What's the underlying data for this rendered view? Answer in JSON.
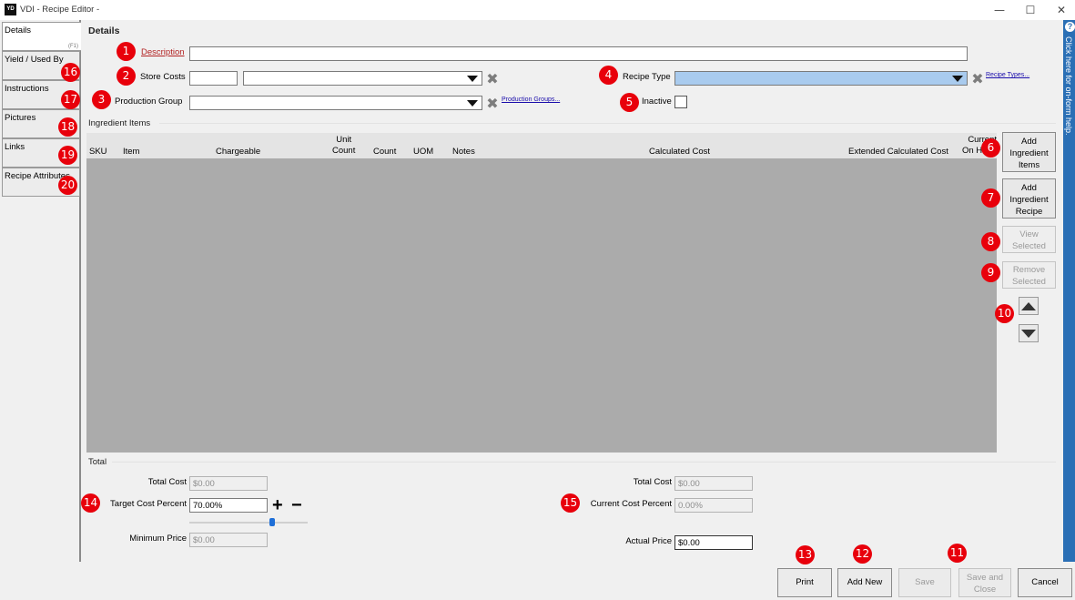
{
  "window": {
    "icon_text": "YD",
    "title": "VDI - Recipe Editor -",
    "minimize": "—",
    "maximize": "☐",
    "close": "✕"
  },
  "sidebar": {
    "tabs": [
      {
        "label": "Details",
        "key": "(F1)"
      },
      {
        "label": "Yield / Used By"
      },
      {
        "label": "Instructions"
      },
      {
        "label": "Pictures"
      },
      {
        "label": "Links"
      },
      {
        "label": "Recipe Attributes"
      }
    ]
  },
  "badges": [
    "1",
    "2",
    "3",
    "4",
    "5",
    "6",
    "7",
    "8",
    "9",
    "10",
    "11",
    "12",
    "13",
    "14",
    "15",
    "16",
    "17",
    "18",
    "19",
    "20"
  ],
  "details": {
    "heading": "Details",
    "description_label": "Description",
    "description_value": "",
    "store_costs_label": "Store Costs",
    "store_costs_value": "",
    "production_group_label": "Production Group",
    "production_groups_link": "Production Groups...",
    "recipe_type_label": "Recipe Type",
    "recipe_types_link": "Recipe Types...",
    "inactive_label": "Inactive",
    "inactive_checked": false
  },
  "ingredients": {
    "section_label": "Ingredient Items",
    "columns": [
      {
        "label": "SKU"
      },
      {
        "label": "Item"
      },
      {
        "label": "Chargeable"
      },
      {
        "label": "Unit\nCount"
      },
      {
        "label": "Count"
      },
      {
        "label": "UOM"
      },
      {
        "label": "Notes"
      },
      {
        "label": "Calculated Cost"
      },
      {
        "label": "Extended Calculated Cost"
      },
      {
        "label": "Current\nOn Hand"
      }
    ],
    "rows": [],
    "side_buttons": {
      "add_items": "Add\nIngredient\nItems",
      "add_recipe": "Add\nIngredient\nRecipe",
      "view_selected": "View\nSelected",
      "remove_selected": "Remove\nSelected"
    }
  },
  "totals": {
    "section_label": "Total",
    "total_cost_label": "Total Cost",
    "total_cost_value": "$0.00",
    "target_cost_percent_label": "Target Cost Percent",
    "target_cost_percent_value": "70.00%",
    "target_cost_slider_fraction": 0.7,
    "plus_symbol": "+",
    "minus_symbol": "−",
    "minimum_price_label": "Minimum Price",
    "minimum_price_value": "$0.00",
    "current_total_cost_label": "Total Cost",
    "current_total_cost_value": "$0.00",
    "current_cost_percent_label": "Current Cost Percent",
    "current_cost_percent_value": "0.00%",
    "actual_price_label": "Actual Price",
    "actual_price_value": "$0.00"
  },
  "footer": {
    "print": "Print",
    "add_new": "Add New",
    "save": "Save",
    "save_and_close": "Save and\nClose",
    "cancel": "Cancel"
  },
  "help": {
    "q": "?",
    "text": "Click here for on-form help."
  },
  "colors": {
    "badge": "#e8000b",
    "recipe_type_highlight": "#a9cbee",
    "grid_body": "#ababab",
    "help_strip": "#2a6fb5",
    "required_label": "#b22222"
  }
}
